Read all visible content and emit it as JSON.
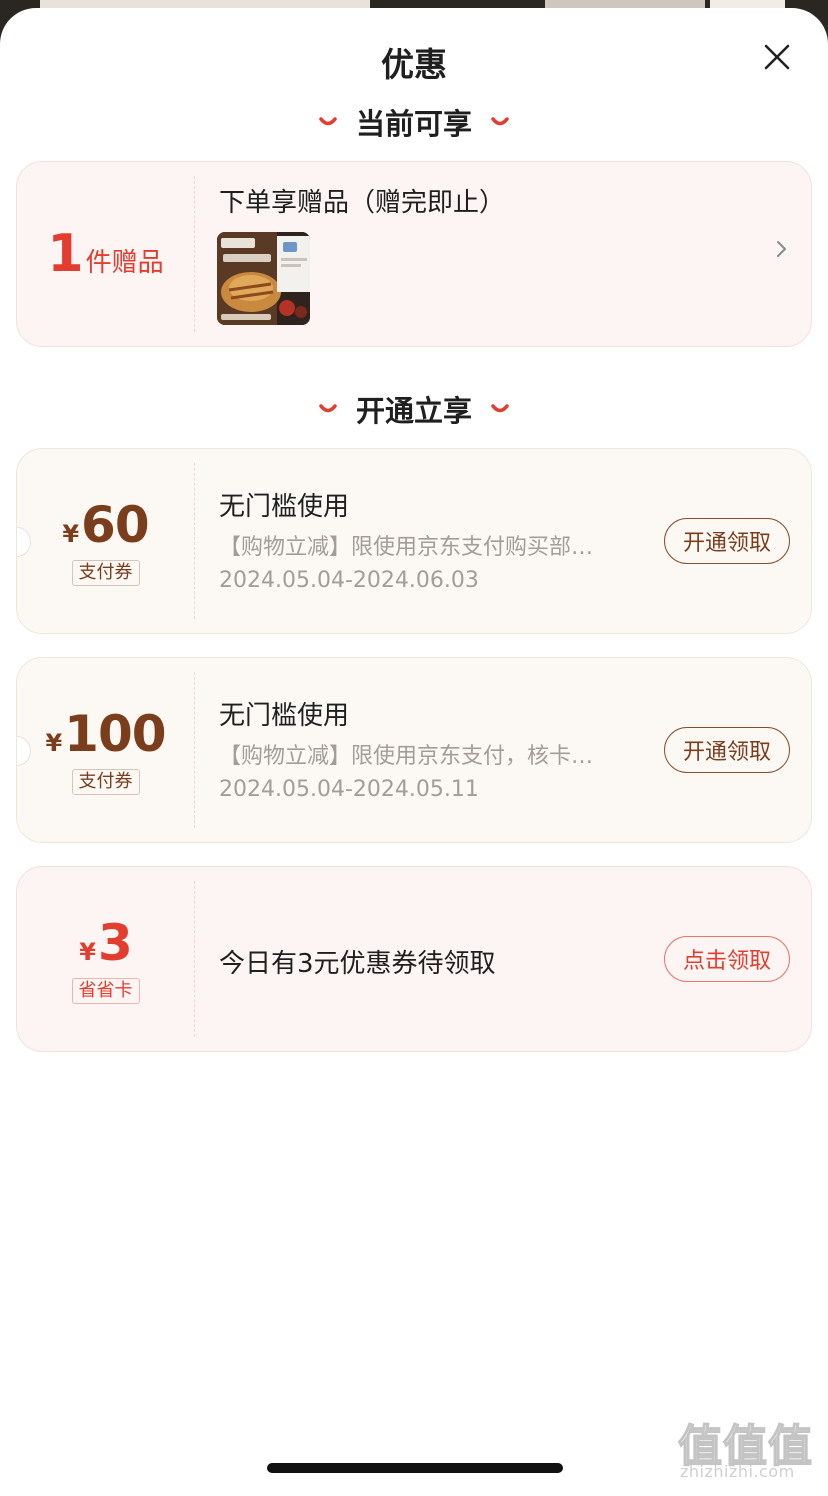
{
  "sheet": {
    "title": "优惠",
    "close_icon": "close-icon"
  },
  "sections": {
    "current": {
      "label": "当前可享"
    },
    "open": {
      "label": "开通立享"
    }
  },
  "gift_card": {
    "count": "1",
    "unit_label": "件赠品",
    "title": "下单享赠品（赠完即止）",
    "thumbnail_icon": "product-thumbnail",
    "chevron_icon": "chevron-right-icon"
  },
  "coupons": [
    {
      "currency": "¥",
      "amount": "60",
      "tag": "支付券",
      "title": "无门槛使用",
      "desc": "【购物立减】限使用京东支付购买部…",
      "date": "2024.05.04-2024.06.03",
      "button": "开通领取"
    },
    {
      "currency": "¥",
      "amount": "100",
      "tag": "支付券",
      "title": "无门槛使用",
      "desc": "【购物立减】限使用京东支付，核卡…",
      "date": "2024.05.04-2024.05.11",
      "button": "开通领取"
    }
  ],
  "saver_card": {
    "currency": "¥",
    "amount": "3",
    "tag": "省省卡",
    "title": "今日有3元优惠券待领取",
    "button": "点击领取"
  },
  "watermark": {
    "main": "值值值",
    "sub": "zhizhizhi.com"
  },
  "colors": {
    "accent_red": "#e23d2f",
    "accent_brown": "#7a3e1d",
    "card_pink": "#fcf5f3",
    "card_cream": "#fcf9f5"
  }
}
